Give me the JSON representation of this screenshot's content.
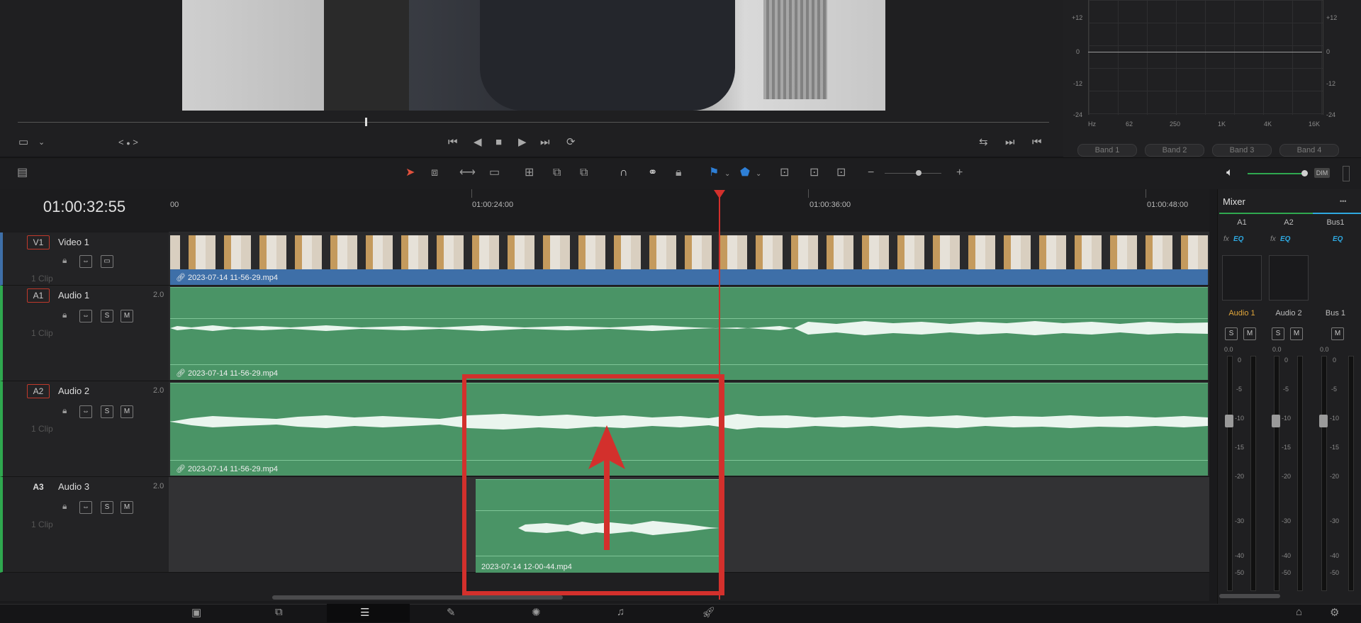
{
  "viewer": {
    "nav_prev": "<",
    "nav_dot": "●",
    "nav_next": ">"
  },
  "eq": {
    "db_left": [
      "+12",
      "0",
      "-12",
      "-24"
    ],
    "db_right": [
      "+12",
      "0",
      "-12",
      "-24"
    ],
    "freqs": [
      "Hz",
      "62",
      "250",
      "1K",
      "4K",
      "16K"
    ],
    "bands": [
      "Band 1",
      "Band 2",
      "Band 3",
      "Band 4"
    ]
  },
  "timeline": {
    "timecode": "01:00:32:55",
    "ruler": [
      "00",
      "01:00:24:00",
      "01:00:36:00",
      "01:00:48:00"
    ],
    "tracks": [
      {
        "badge": "V1",
        "name": "Video 1",
        "channels": "",
        "clips": "1 Clip",
        "clip_name": "2023-07-14 11-56-29.mp4"
      },
      {
        "badge": "A1",
        "name": "Audio 1",
        "channels": "2.0",
        "clips": "1 Clip",
        "clip_name": "2023-07-14 11-56-29.mp4"
      },
      {
        "badge": "A2",
        "name": "Audio 2",
        "channels": "2.0",
        "clips": "1 Clip",
        "clip_name": "2023-07-14 11-56-29.mp4"
      },
      {
        "badge": "A3",
        "name": "Audio 3",
        "channels": "2.0",
        "clips": "1 Clip",
        "clip_name": "2023-07-14 12-00-44.mp4"
      }
    ],
    "solo": "S",
    "mute": "M"
  },
  "toolbar": {
    "dim_label": "DIM"
  },
  "mixer": {
    "title": "Mixer",
    "more": "•••",
    "columns": [
      "A1",
      "A2",
      "Bus1"
    ],
    "fx": "fx",
    "eq": "EQ",
    "strip_names": [
      "Audio 1",
      "Audio 2",
      "Bus 1"
    ],
    "levels": [
      "0.0",
      "0.0",
      "0.0"
    ],
    "scale": [
      "0",
      "-5",
      "-10",
      "-15",
      "-20",
      "-30",
      "-40",
      "-50"
    ]
  },
  "colors": {
    "audio_clip": "#4a9466",
    "video_clip": "#3e6fa8",
    "playhead": "#d3302c",
    "annotation": "#d3302c",
    "accent": "#2ea8e0"
  }
}
